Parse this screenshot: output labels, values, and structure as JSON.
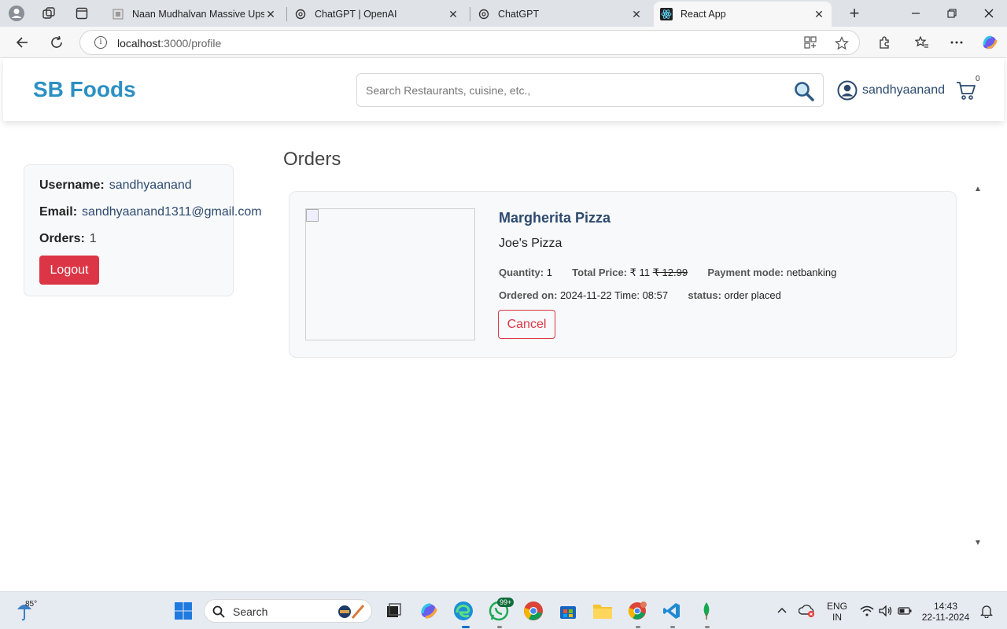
{
  "browser": {
    "tabs": [
      {
        "title": "Naan Mudhalvan Massive Upskill",
        "active": false
      },
      {
        "title": "ChatGPT | OpenAI",
        "active": false
      },
      {
        "title": "ChatGPT",
        "active": false
      },
      {
        "title": "React App",
        "active": true
      }
    ],
    "url_host": "localhost",
    "url_rest": ":3000/profile"
  },
  "navbar": {
    "brand": "SB Foods",
    "search_placeholder": "Search Restaurants, cuisine, etc.,",
    "username": "sandhyaanand",
    "cart_count": "0"
  },
  "profile": {
    "username_label": "Username:",
    "username": "sandhyaanand",
    "email_label": "Email:",
    "email": "sandhyaanand1311@gmail.com",
    "orders_label": "Orders:",
    "orders_count": "1",
    "logout_label": "Logout"
  },
  "orders": {
    "title": "Orders",
    "items": [
      {
        "name": "Margherita Pizza",
        "restaurant": "Joe's Pizza",
        "quantity_label": "Quantity:",
        "quantity": "1",
        "total_price_label": "Total Price:",
        "price": "₹ 11",
        "original_price": "₹ 12.99",
        "payment_label": "Payment mode:",
        "payment_mode": "netbanking",
        "ordered_on_label": "Ordered on:",
        "ordered_on": "2024-11-22 Time: 08:57",
        "status_label": "status:",
        "status": "order placed",
        "cancel_label": "Cancel"
      }
    ]
  },
  "taskbar": {
    "weather_temp": "85°",
    "search_label": "Search",
    "whatsapp_badge": "99+",
    "lang_top": "ENG",
    "lang_bottom": "IN",
    "time": "14:43",
    "date": "22-11-2024"
  },
  "colors": {
    "brand": "#2b8fc3",
    "danger": "#dc3545",
    "text_blue": "#2c4a6e"
  }
}
